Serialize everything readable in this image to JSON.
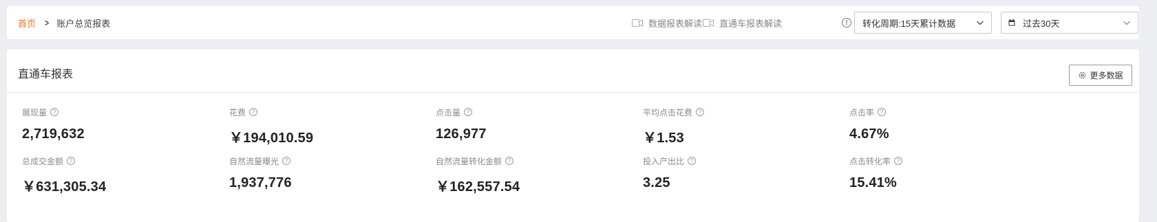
{
  "breadcrumb": {
    "home": "首页",
    "current": "账户总览报表"
  },
  "toolbar": {
    "data_report_guide": "数据报表解读",
    "ztc_report_guide": "直通车报表解读",
    "period_select": "转化周期:15天累计数据",
    "date_select": "过去30天"
  },
  "card": {
    "title": "直通车报表",
    "more_button": "更多数据"
  },
  "metrics": [
    {
      "label": "展现量",
      "value": "2,719,632"
    },
    {
      "label": "花费",
      "value": "￥194,010.59"
    },
    {
      "label": "点击量",
      "value": "126,977"
    },
    {
      "label": "平均点击花费",
      "value": "￥1.53"
    },
    {
      "label": "点击率",
      "value": "4.67%"
    },
    {
      "label": "总成交金额",
      "value": "￥631,305.34"
    },
    {
      "label": "自然流量曝光",
      "value": "1,937,776"
    },
    {
      "label": "自然流量转化金额",
      "value": "￥162,557.54"
    },
    {
      "label": "投入产出比",
      "value": "3.25"
    },
    {
      "label": "点击转化率",
      "value": "15.41%"
    }
  ],
  "colors": {
    "accent": "#e8731f",
    "background": "#eceef2"
  }
}
